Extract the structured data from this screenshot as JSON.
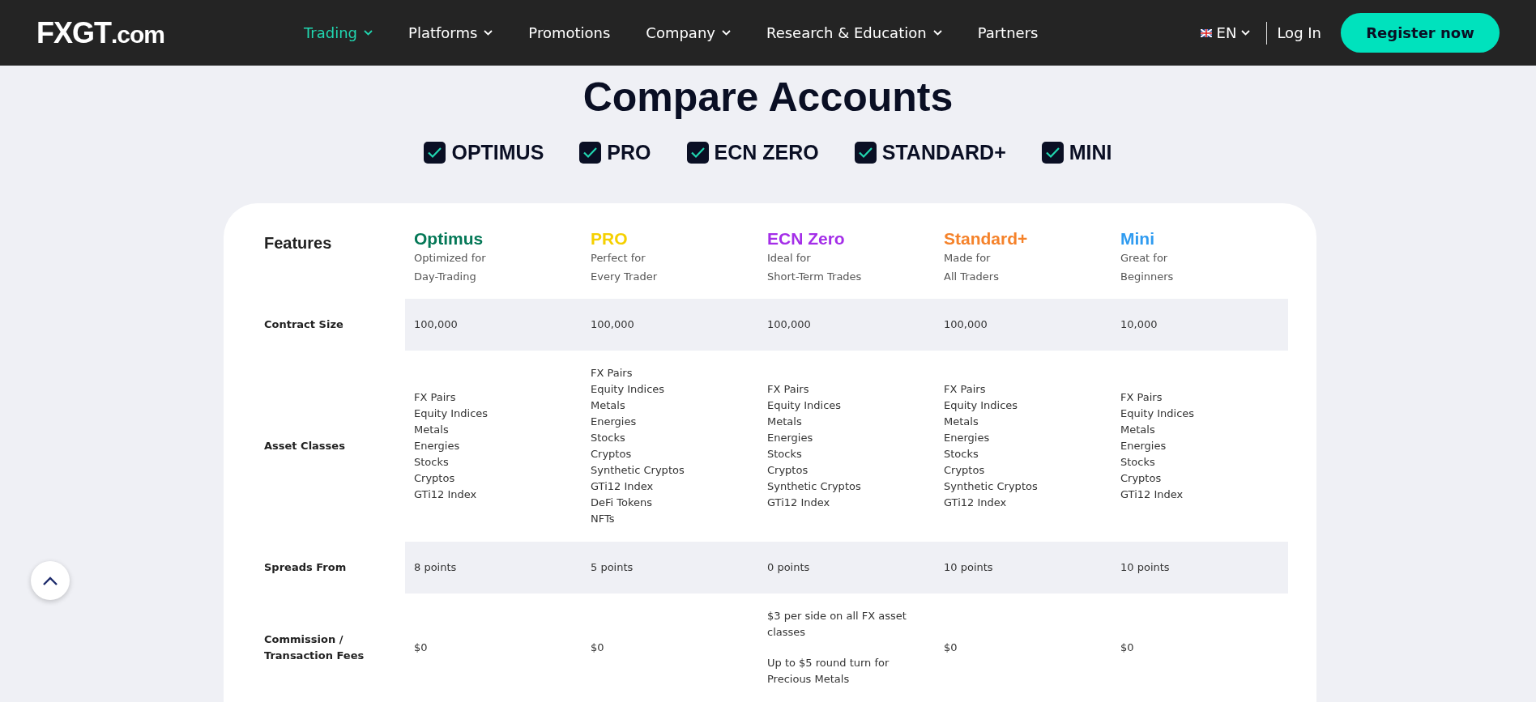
{
  "header": {
    "logo": {
      "main": "FXGT",
      "suffix": ".com"
    },
    "nav": [
      {
        "label": "Trading",
        "dropdown": true,
        "selected": true
      },
      {
        "label": "Platforms",
        "dropdown": true,
        "selected": false
      },
      {
        "label": "Promotions",
        "dropdown": false,
        "selected": false
      },
      {
        "label": "Company",
        "dropdown": true,
        "selected": false
      },
      {
        "label": "Research & Education",
        "dropdown": true,
        "selected": false
      },
      {
        "label": "Partners",
        "dropdown": false,
        "selected": false
      }
    ],
    "language": "EN",
    "login": "Log In",
    "register": "Register now"
  },
  "title": "Compare Accounts",
  "filters": [
    {
      "label": "OPTIMUS",
      "checked": true
    },
    {
      "label": "PRO",
      "checked": true
    },
    {
      "label": "ECN ZERO",
      "checked": true
    },
    {
      "label": "STANDARD+",
      "checked": true
    },
    {
      "label": "MINI",
      "checked": true
    }
  ],
  "table": {
    "corner": "Features",
    "accounts": [
      {
        "name": "Optimus",
        "color": "#047857",
        "tagline": [
          "Optimized for",
          "Day-Trading"
        ]
      },
      {
        "name": "PRO",
        "color": "#f5d000",
        "tagline": [
          "Perfect for",
          "Every Trader"
        ]
      },
      {
        "name": "ECN Zero",
        "color": "#a42ee8",
        "tagline": [
          "Ideal for",
          "Short-Term Trades"
        ]
      },
      {
        "name": "Standard+",
        "color": "#f5822a",
        "tagline": [
          "Made for",
          "All Traders"
        ]
      },
      {
        "name": "Mini",
        "color": "#2f9bf0",
        "tagline": [
          "Great for",
          "Beginners"
        ]
      }
    ],
    "rows": [
      {
        "label": "Contract Size",
        "shaded": true,
        "cells": [
          [
            "100,000"
          ],
          [
            "100,000"
          ],
          [
            "100,000"
          ],
          [
            "100,000"
          ],
          [
            "10,000"
          ]
        ]
      },
      {
        "label": "Asset Classes",
        "shaded": false,
        "cells": [
          [
            "FX Pairs",
            "Equity Indices",
            "Metals",
            "Energies",
            "Stocks",
            "Cryptos",
            "GTi12 Index"
          ],
          [
            "FX Pairs",
            "Equity Indices",
            "Metals",
            "Energies",
            "Stocks",
            "Cryptos",
            "Synthetic Cryptos",
            "GTi12 Index",
            "DeFi Tokens",
            "NFTs"
          ],
          [
            "FX Pairs",
            "Equity Indices",
            "Metals",
            "Energies",
            "Stocks",
            "Cryptos",
            "Synthetic Cryptos",
            "GTi12 Index"
          ],
          [
            "FX Pairs",
            "Equity Indices",
            "Metals",
            "Energies",
            "Stocks",
            "Cryptos",
            "Synthetic Cryptos",
            "GTi12 Index"
          ],
          [
            "FX Pairs",
            "Equity Indices",
            "Metals",
            "Energies",
            "Stocks",
            "Cryptos",
            "GTi12 Index"
          ]
        ]
      },
      {
        "label": "Spreads From",
        "shaded": true,
        "cells": [
          [
            "8 points"
          ],
          [
            "5 points"
          ],
          [
            "0 points"
          ],
          [
            "10 points"
          ],
          [
            "10 points"
          ]
        ]
      },
      {
        "label": "Commission / Transaction Fees",
        "shaded": false,
        "paragraphs": true,
        "cells": [
          [
            "$0"
          ],
          [
            "$0"
          ],
          [
            "$3 per side on all FX asset classes",
            "Up to $5 round turn for Precious Metals"
          ],
          [
            "$0"
          ],
          [
            "$0"
          ]
        ]
      }
    ]
  }
}
